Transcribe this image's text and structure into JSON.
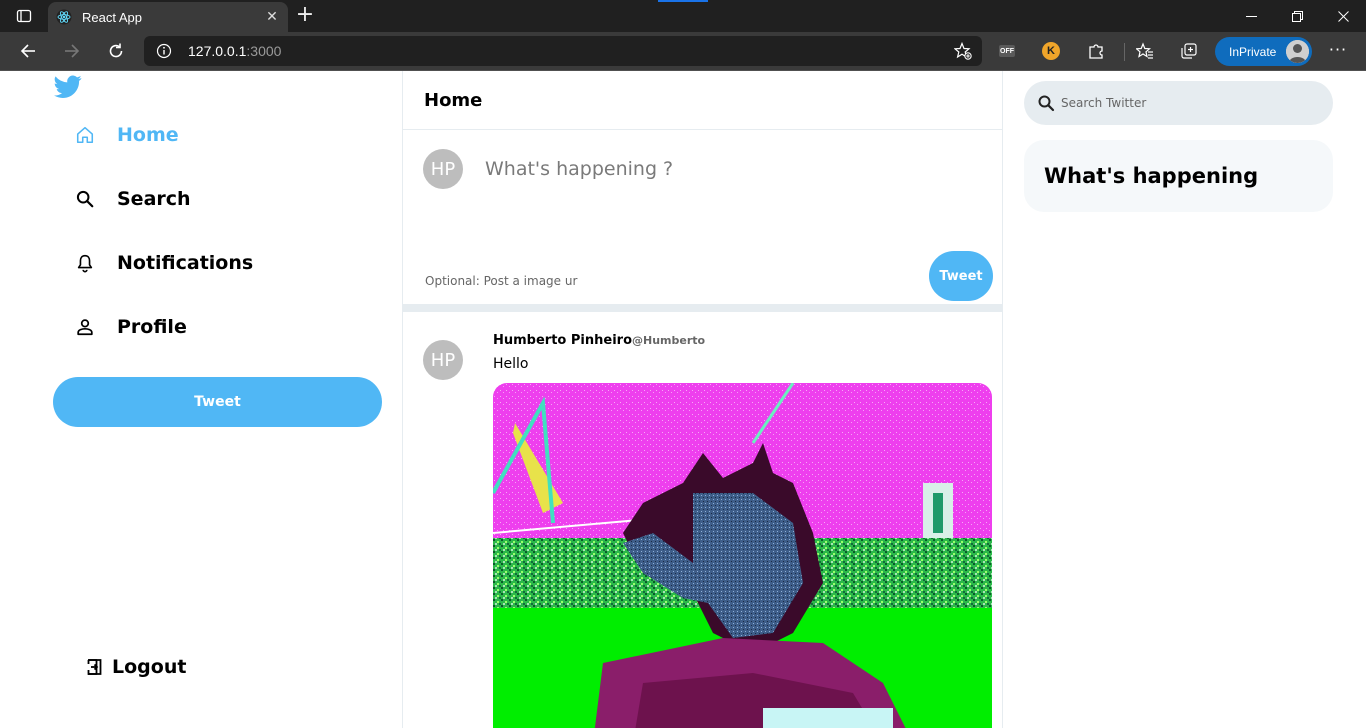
{
  "browser": {
    "tab_title": "React App",
    "url_host": "127.0.0.1",
    "url_port": ":3000",
    "inprivate_label": "InPrivate",
    "extension_off_label": "OFF",
    "extension_k_label": "K"
  },
  "sidebar": {
    "items": [
      {
        "label": "Home",
        "icon": "home-icon",
        "active": true
      },
      {
        "label": "Search",
        "icon": "search-icon"
      },
      {
        "label": "Notifications",
        "icon": "bell-icon"
      },
      {
        "label": "Profile",
        "icon": "person-icon"
      }
    ],
    "tweet_button": "Tweet",
    "logout": "Logout"
  },
  "feed": {
    "title": "Home",
    "composer": {
      "avatar_initials": "HP",
      "placeholder": "What's happening ?",
      "image_placeholder": "Optional: Post a image ur",
      "tweet_button": "Tweet"
    },
    "posts": [
      {
        "avatar_initials": "HP",
        "display_name": "Humberto Pinheiro",
        "username": "@Humberto",
        "text": "Hello",
        "image": "pixel-art-horse-head-man"
      }
    ]
  },
  "widgets": {
    "search_placeholder": "Search Twitter",
    "trends_title": "What's happening"
  },
  "colors": {
    "accent": "#50b7f5",
    "border": "#e6ecf0",
    "widget_bg": "#f5f8fa",
    "inprivate": "#0f6cbd"
  }
}
